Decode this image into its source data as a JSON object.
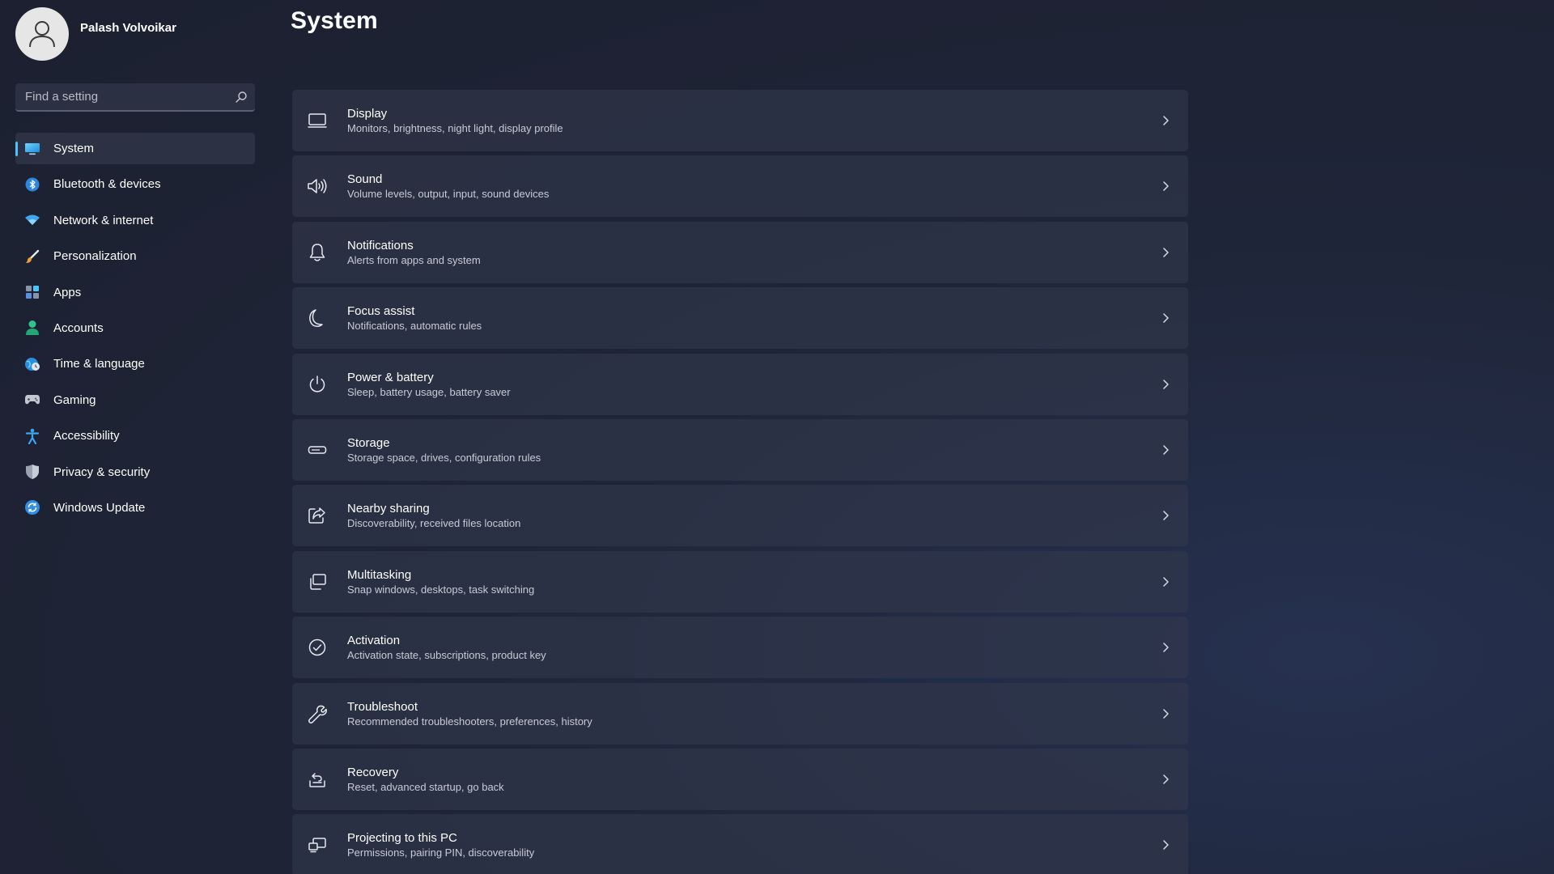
{
  "window": {
    "page_title": "System"
  },
  "profile": {
    "name": "Palash Volvoikar"
  },
  "search": {
    "placeholder": "Find a setting",
    "icon": "search-icon"
  },
  "sidebar": {
    "accent_color": "#4cc2ff",
    "items": [
      {
        "label": "System",
        "icon": "monitor-icon",
        "selected": true
      },
      {
        "label": "Bluetooth & devices",
        "icon": "bluetooth-icon"
      },
      {
        "label": "Network & internet",
        "icon": "wifi-icon"
      },
      {
        "label": "Personalization",
        "icon": "brush-icon"
      },
      {
        "label": "Apps",
        "icon": "apps-icon"
      },
      {
        "label": "Accounts",
        "icon": "person-icon"
      },
      {
        "label": "Time & language",
        "icon": "globe-clock-icon"
      },
      {
        "label": "Gaming",
        "icon": "gamepad-icon"
      },
      {
        "label": "Accessibility",
        "icon": "accessibility-icon"
      },
      {
        "label": "Privacy & security",
        "icon": "shield-icon"
      },
      {
        "label": "Windows Update",
        "icon": "update-icon"
      }
    ]
  },
  "settings": [
    {
      "title": "Display",
      "subtitle": "Monitors, brightness, night light, display profile",
      "icon": "display-icon"
    },
    {
      "title": "Sound",
      "subtitle": "Volume levels, output, input, sound devices",
      "icon": "speaker-icon"
    },
    {
      "title": "Notifications",
      "subtitle": "Alerts from apps and system",
      "icon": "bell-icon"
    },
    {
      "title": "Focus assist",
      "subtitle": "Notifications, automatic rules",
      "icon": "moon-icon"
    },
    {
      "title": "Power & battery",
      "subtitle": "Sleep, battery usage, battery saver",
      "icon": "power-icon"
    },
    {
      "title": "Storage",
      "subtitle": "Storage space, drives, configuration rules",
      "icon": "storage-drive-icon"
    },
    {
      "title": "Nearby sharing",
      "subtitle": "Discoverability, received files location",
      "icon": "share-icon"
    },
    {
      "title": "Multitasking",
      "subtitle": "Snap windows, desktops, task switching",
      "icon": "multitasking-icon"
    },
    {
      "title": "Activation",
      "subtitle": "Activation state, subscriptions, product key",
      "icon": "check-circle-icon"
    },
    {
      "title": "Troubleshoot",
      "subtitle": "Recommended troubleshooters, preferences, history",
      "icon": "wrench-icon"
    },
    {
      "title": "Recovery",
      "subtitle": "Reset, advanced startup, go back",
      "icon": "recovery-icon"
    },
    {
      "title": "Projecting to this PC",
      "subtitle": "Permissions, pairing PIN, discoverability",
      "icon": "projecting-icon"
    }
  ]
}
